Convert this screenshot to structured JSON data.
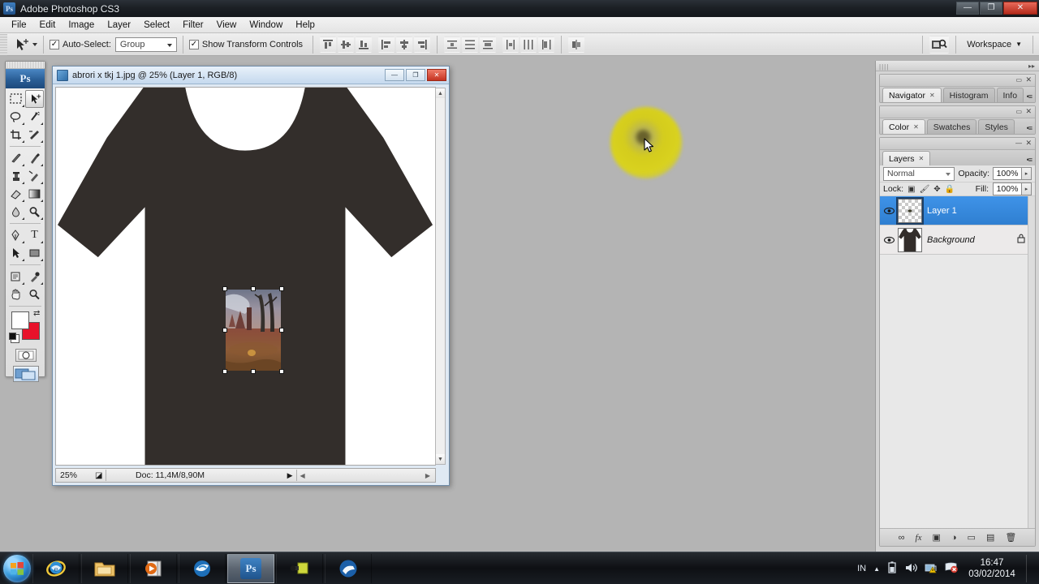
{
  "app": {
    "title": "Adobe Photoshop CS3",
    "logo_text": "Ps",
    "window_controls": {
      "minimize": "—",
      "restore": "❐",
      "close": "✕"
    }
  },
  "menubar": {
    "items": [
      "File",
      "Edit",
      "Image",
      "Layer",
      "Select",
      "Filter",
      "View",
      "Window",
      "Help"
    ]
  },
  "options_bar": {
    "tool_icon": "move-tool-icon",
    "auto_select_checked": "✓",
    "auto_select_label": "Auto-Select:",
    "auto_select_value": "Group",
    "show_transform_checked": "✓",
    "show_transform_label": "Show Transform Controls",
    "align_group_1": [
      "align-top-edges-icon",
      "align-vertical-centers-icon",
      "align-bottom-edges-icon"
    ],
    "align_group_2": [
      "align-left-edges-icon",
      "align-horizontal-centers-icon",
      "align-right-edges-icon"
    ],
    "distribute_group_1": [
      "distribute-top-edges-icon",
      "distribute-vertical-centers-icon",
      "distribute-bottom-edges-icon"
    ],
    "distribute_group_2": [
      "distribute-left-edges-icon",
      "distribute-horizontal-centers-icon",
      "distribute-right-edges-icon"
    ],
    "link_icon": "auto-align-layers-icon",
    "workspace_label": "Workspace",
    "workspace_arrow": "▼"
  },
  "toolbox": {
    "logo_text": "Ps",
    "tools": [
      {
        "name": "marquee-tool",
        "glyph": "▭"
      },
      {
        "name": "move-tool",
        "glyph": "✥",
        "selected": true
      },
      {
        "name": "lasso-tool",
        "glyph": "◯"
      },
      {
        "name": "magic-wand-tool",
        "glyph": "✦"
      },
      {
        "name": "crop-tool",
        "glyph": "⌗"
      },
      {
        "name": "slice-tool",
        "glyph": "✂"
      },
      {
        "name": "healing-brush-tool",
        "glyph": "✎"
      },
      {
        "name": "brush-tool",
        "glyph": "🖌"
      },
      {
        "name": "clone-stamp-tool",
        "glyph": "⚑"
      },
      {
        "name": "history-brush-tool",
        "glyph": "✒"
      },
      {
        "name": "eraser-tool",
        "glyph": "◰"
      },
      {
        "name": "gradient-tool",
        "glyph": "▤"
      },
      {
        "name": "blur-tool",
        "glyph": "💧"
      },
      {
        "name": "dodge-tool",
        "glyph": "●"
      },
      {
        "name": "pen-tool",
        "glyph": "✐"
      },
      {
        "name": "type-tool",
        "glyph": "T"
      },
      {
        "name": "path-selection-tool",
        "glyph": "➤"
      },
      {
        "name": "rectangle-tool",
        "glyph": "▢"
      },
      {
        "name": "notes-tool",
        "glyph": "▤"
      },
      {
        "name": "eyedropper-tool",
        "glyph": "⚲"
      },
      {
        "name": "hand-tool",
        "glyph": "✋"
      },
      {
        "name": "zoom-tool",
        "glyph": "⚲"
      }
    ],
    "foreground_color": "#ffffff",
    "background_color": "#e8122a",
    "quick_mask_icon": "quick-mask-mode-icon",
    "screen_mode_icon": "screen-mode-icon"
  },
  "document": {
    "title": "abrori x tkj 1.jpg @ 25% (Layer 1, RGB/8)",
    "zoom": "25%",
    "doc_size": "Doc: 11,4M/8,90M",
    "minimize": "—",
    "maximize": "❐",
    "close": "✕",
    "shirt_color": "#332e2b",
    "canvas_background": "#ffffff"
  },
  "panels": {
    "group_1": {
      "tabs": [
        {
          "label": "Navigator",
          "active": true,
          "closable": "✕"
        },
        {
          "label": "Histogram",
          "active": false
        },
        {
          "label": "Info",
          "active": false
        }
      ]
    },
    "group_2": {
      "tabs": [
        {
          "label": "Color",
          "active": true,
          "closable": "✕"
        },
        {
          "label": "Swatches",
          "active": false
        },
        {
          "label": "Styles",
          "active": false
        }
      ]
    },
    "layers": {
      "tab_label": "Layers",
      "tab_close": "✕",
      "blend_mode": "Normal",
      "opacity_label": "Opacity:",
      "opacity_value": "100%",
      "fill_label": "Fill:",
      "fill_value": "100%",
      "lock_label": "Lock:",
      "lock_icons": [
        "lock-transparent-pixels-icon",
        "lock-image-pixels-icon",
        "lock-position-icon",
        "lock-all-icon"
      ],
      "rows": [
        {
          "name": "Layer 1",
          "selected": true,
          "visible": "👁",
          "thumb": "transparent-checker",
          "locked": false
        },
        {
          "name": "Background",
          "selected": false,
          "visible": "👁",
          "thumb": "shirt",
          "locked": true,
          "lock_glyph": "🔒"
        }
      ],
      "footer_icons": [
        {
          "name": "link-layers-icon",
          "glyph": "∞"
        },
        {
          "name": "layer-style-fx-icon",
          "glyph": "fx"
        },
        {
          "name": "add-layer-mask-icon",
          "glyph": "▣"
        },
        {
          "name": "new-adjustment-layer-icon",
          "glyph": "◑"
        },
        {
          "name": "new-group-icon",
          "glyph": "▭"
        },
        {
          "name": "new-layer-icon",
          "glyph": "▤"
        },
        {
          "name": "delete-layer-icon",
          "glyph": "🗑"
        }
      ]
    }
  },
  "taskbar": {
    "start_label": "start-orb",
    "items": [
      {
        "name": "internet-explorer",
        "active": false
      },
      {
        "name": "windows-explorer",
        "active": false
      },
      {
        "name": "media-player",
        "active": false
      },
      {
        "name": "browser",
        "active": false
      },
      {
        "name": "photoshop",
        "active": true,
        "glyph": "Ps"
      },
      {
        "name": "flashlight-app",
        "active": false
      },
      {
        "name": "paint-app",
        "active": false
      }
    ],
    "tray": {
      "language": "IN",
      "show_hidden": "▲",
      "icons": [
        "battery-icon",
        "volume-icon",
        "network-warning-icon",
        "action-center-icon"
      ],
      "time": "16:47",
      "date": "03/02/2014"
    }
  }
}
